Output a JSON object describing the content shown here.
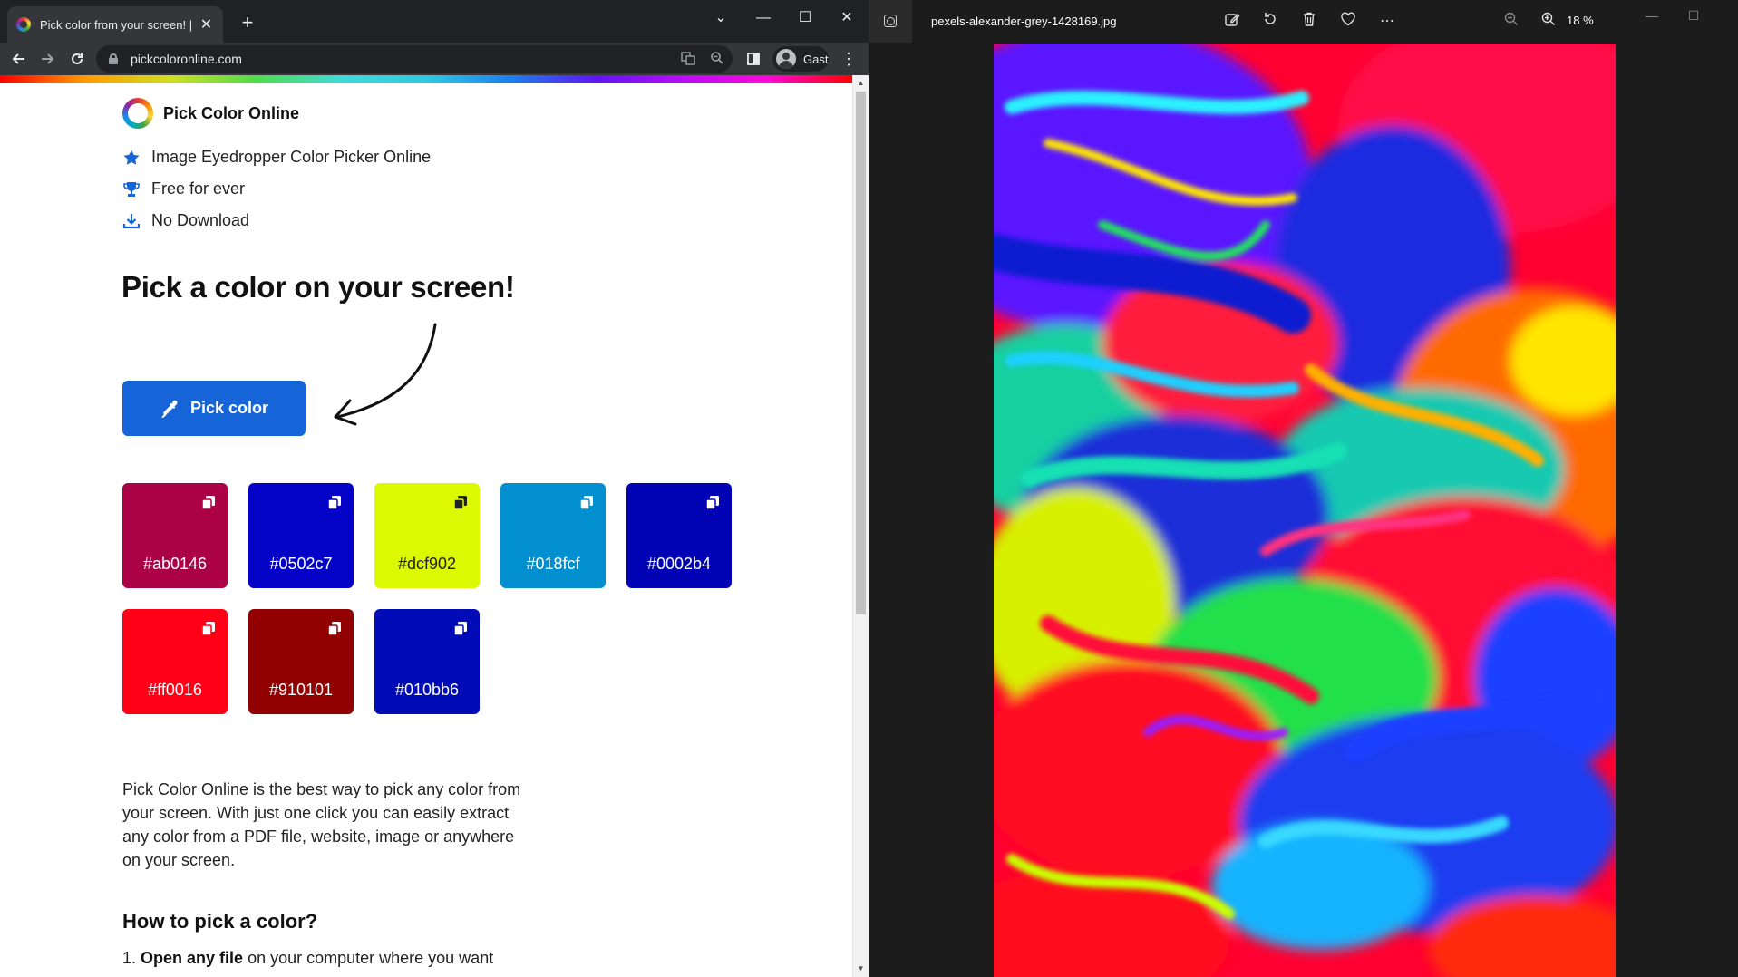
{
  "browser": {
    "tab_title": "Pick color from your screen! | Pick Color Online",
    "tab_close": "✕",
    "new_tab": "+",
    "window_controls": {
      "dropdown": "⌄",
      "minimize": "—",
      "maximize": "☐",
      "close": "✕"
    },
    "url": "pickcoloronline.com",
    "profile_label": "Gast",
    "icons": {
      "back": "arrow-left-icon",
      "forward": "arrow-right-icon",
      "reload": "reload-icon",
      "translate": "translate-icon",
      "zoom": "zoom-icon",
      "sidepanel": "side-panel-icon",
      "menu": "kebab-menu-icon"
    }
  },
  "site": {
    "name": "Pick Color Online",
    "features": [
      {
        "icon": "star-icon",
        "text": "Image Eyedropper Color Picker Online"
      },
      {
        "icon": "trophy-icon",
        "text": "Free for ever"
      },
      {
        "icon": "download-icon",
        "text": "No Download"
      }
    ],
    "headline": "Pick a color on your screen!",
    "pick_button_label": "Pick color",
    "swatches": [
      {
        "hex": "#ab0146",
        "color": "#ab0146",
        "text_color": "#ffffff"
      },
      {
        "hex": "#0502c7",
        "color": "#0502c7",
        "text_color": "#ffffff"
      },
      {
        "hex": "#dcf902",
        "color": "#dcf902",
        "text_color": "#222222"
      },
      {
        "hex": "#018fcf",
        "color": "#018fcf",
        "text_color": "#ffffff"
      },
      {
        "hex": "#0002b4",
        "color": "#0002b4",
        "text_color": "#ffffff"
      },
      {
        "hex": "#ff0016",
        "color": "#ff0016",
        "text_color": "#ffffff"
      },
      {
        "hex": "#910101",
        "color": "#910101",
        "text_color": "#ffffff"
      },
      {
        "hex": "#010bb6",
        "color": "#010bb6",
        "text_color": "#ffffff"
      }
    ],
    "description": "Pick Color Online is the best way to pick any color from your screen. With just one click you can easily extract any color from a PDF file, website, image or anywhere on your screen.",
    "how_heading": "How to pick a color?",
    "step_one": {
      "number": "1.",
      "bold": "Open any file",
      "rest": " on your computer where you want"
    }
  },
  "viewer": {
    "file_name": "pexels-alexander-grey-1428169.jpg",
    "zoom_level": "18 %",
    "tools": [
      "edit-image-icon",
      "rotate-icon",
      "delete-icon",
      "favorite-icon",
      "more-icon",
      "zoom-out-icon",
      "zoom-in-icon"
    ]
  }
}
